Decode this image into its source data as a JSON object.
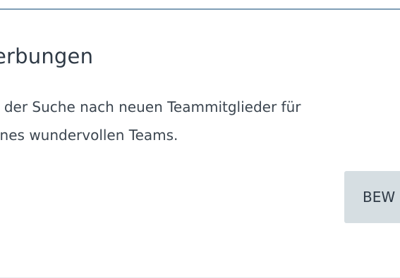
{
  "card": {
    "title": "erbungen",
    "description_lines": [
      "' der Suche nach neuen Teammitglieder für",
      "ines wundervollen Teams."
    ],
    "button_label": "BEW"
  },
  "colors": {
    "accent_border": "#7f9eb6",
    "button_bg": "#d6dee2",
    "text": "#2f3a46"
  }
}
